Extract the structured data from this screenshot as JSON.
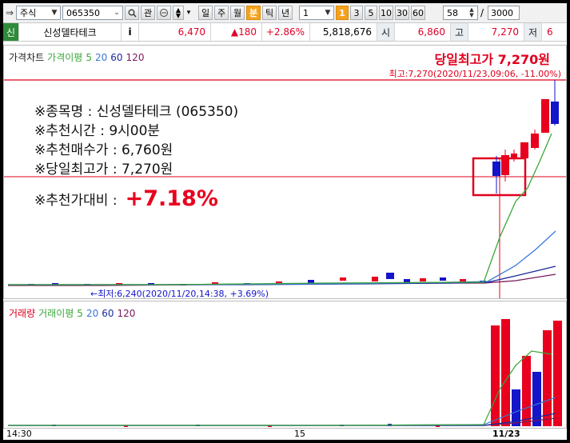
{
  "toolbar": {
    "market": "주식",
    "code": "065350",
    "btn_kwan": "관",
    "periods": [
      "일",
      "주",
      "월",
      "분",
      "틱",
      "년"
    ],
    "active_period": "분",
    "interval_value": "1",
    "interval_badge": "1",
    "intervals": [
      "3",
      "5",
      "10",
      "30",
      "60"
    ],
    "count_value": "58",
    "slash": "/",
    "max_count": "3000"
  },
  "quote": {
    "badge": "신",
    "name": "신성델타테크",
    "info_btn": "i",
    "price": "6,470",
    "change": "▲180",
    "change_pct": "+2.86%",
    "volume": "5,818,676",
    "open_label": "시",
    "open": "6,860",
    "high_label": "고",
    "high": "7,270",
    "low_label": "저",
    "low_cut": "6"
  },
  "price_panel": {
    "legend": {
      "title": "가격차트",
      "ma_label": "가격이평",
      "ma5": "5",
      "ma20": "20",
      "ma60": "60",
      "ma120": "120"
    },
    "headline": "당일최고가 7,270원",
    "high_marker": "최고:7,270(2020/11/23,09:06, -11.00%)",
    "low_marker": "←최저:6,240(2020/11/20,14:38, +3.69%)",
    "info_lines": [
      "※종목명 : 신성델타테크 (065350)",
      "※추천시간 : 9시00분",
      "※추천매수가 : 6,760원",
      "※당일최고가 : 7,270원"
    ],
    "ratio_label": "※추천가대비 :",
    "ratio_value": "+7.18%"
  },
  "volume_panel": {
    "legend": {
      "title": "거래량",
      "ma_label": "거래이평",
      "ma5": "5",
      "ma20": "20",
      "ma60": "60",
      "ma120": "120"
    }
  },
  "xaxis": {
    "labels": [
      "14:30",
      "15",
      "11/23"
    ]
  },
  "colors": {
    "up": "#e8001e",
    "down": "#1414c8",
    "ma5": "#3aa63a",
    "ma20": "#3a78d8",
    "ma60": "#1a2a9a",
    "ma120": "#7a1a5a"
  }
}
